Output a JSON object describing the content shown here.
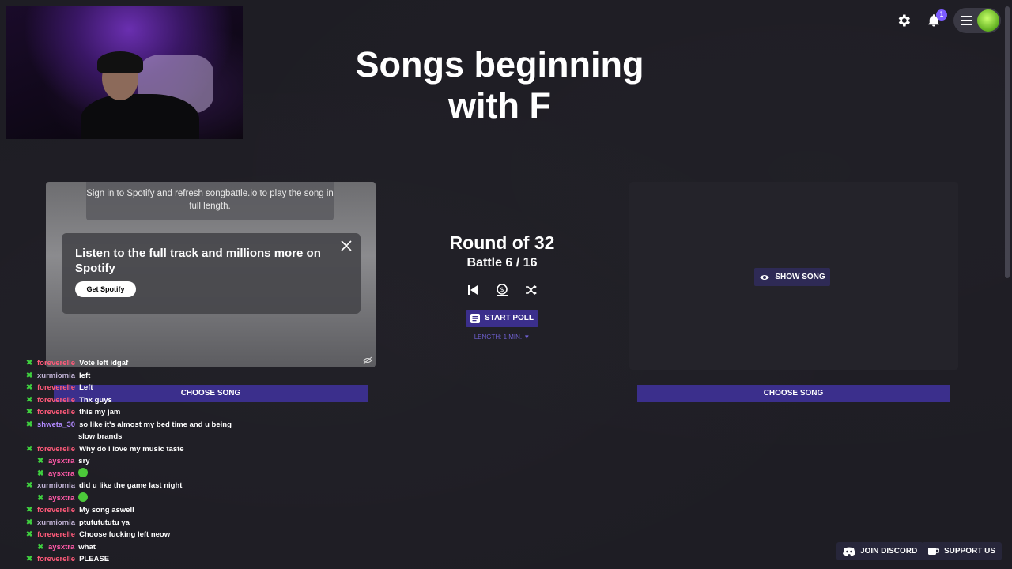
{
  "page": {
    "title": "Songs beginning with F"
  },
  "topbar": {
    "settings_icon": "gear-icon",
    "notifications_icon": "bell-icon",
    "notifications_count": "1",
    "menu_icon": "hamburger-icon"
  },
  "left_panel": {
    "signin_notice": "Sign in to Spotify and refresh songbattle.io to play the song in full length.",
    "promo_text": "Listen to the full track and millions more on Spotify",
    "promo_button": "Get Spotify",
    "choose_label": "CHOOSE SONG"
  },
  "center": {
    "round": "Round of 32",
    "battle": "Battle 6 / 16",
    "start_poll": "START POLL",
    "length": "LENGTH: 1 MIN. ▼"
  },
  "right_panel": {
    "show_song": "SHOW SONG",
    "choose_label": "CHOOSE SONG"
  },
  "chat": {
    "messages": [
      {
        "user": "foreverelle",
        "text": "Vote left idgaf"
      },
      {
        "user": "xurmiomia",
        "text": "left"
      },
      {
        "user": "foreverelle",
        "text": "Left"
      },
      {
        "user": "foreverelle",
        "text": "Thx guys"
      },
      {
        "user": "foreverelle",
        "text": "this my jam"
      },
      {
        "user": "shweta_30",
        "text": "so like it's almost my bed time and u being"
      },
      {
        "user": "",
        "text": "slow brands"
      },
      {
        "user": "foreverelle",
        "text": "Why do I love my music taste"
      },
      {
        "user": "aysxtra",
        "text": "sry"
      },
      {
        "user": "aysxtra",
        "text": ""
      },
      {
        "user": "xurmiomia",
        "text": "did u like the game last night"
      },
      {
        "user": "aysxtra",
        "text": ""
      },
      {
        "user": "foreverelle",
        "text": "My song aswell"
      },
      {
        "user": "xurmiomia",
        "text": "ptututututu ya"
      },
      {
        "user": "foreverelle",
        "text": "Choose fucking left neow"
      },
      {
        "user": "aysxtra",
        "text": "what"
      },
      {
        "user": "foreverelle",
        "text": "PLEASE"
      }
    ]
  },
  "footer": {
    "join_discord": "JOIN DISCORD",
    "support_us": "SUPPORT US"
  },
  "colors": {
    "accent": "#3b2f8c",
    "background": "#1e1d24"
  }
}
